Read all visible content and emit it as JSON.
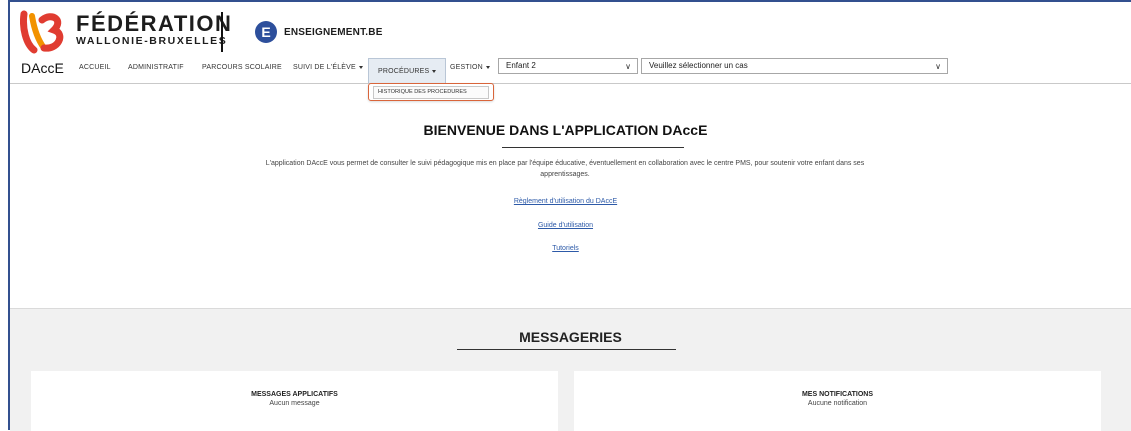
{
  "header": {
    "logo_line1": "FÉDÉRATION",
    "logo_line2": "WALLONIE-BRUXELLES",
    "ens_badge": "E",
    "ens_text": "ENSEIGNEMENT.BE"
  },
  "nav": {
    "app_name": "DAccE",
    "items": [
      {
        "label": "ACCUEIL"
      },
      {
        "label": "ADMINISTRATIF"
      },
      {
        "label": "PARCOURS SCOLAIRE"
      },
      {
        "label": "SUIVI DE L'ÉLÈVE"
      },
      {
        "label": "PROCÉDURES"
      },
      {
        "label": "GESTION"
      }
    ],
    "child_select": "Enfant 2",
    "case_select": "Veuillez sélectionner un cas"
  },
  "dropdown": {
    "item": "HISTORIQUE DES PROCEDURES"
  },
  "welcome": {
    "title": "BIENVENUE DANS L'APPLICATION DAccE",
    "desc_line1": "L'application DAccE vous permet de consulter le suivi pédagogique mis en place par l'équipe éducative, éventuellement en collaboration avec le centre PMS, pour soutenir votre enfant dans ses",
    "desc_line2": "apprentissages.",
    "link_rules": "Règlement d'utilisation du DAccE",
    "link_guide": "Guide d'utilisation",
    "link_tutorials": "Tutoriels"
  },
  "messageries": {
    "title": "MESSAGERIES",
    "card1_title": "MESSAGES APPLICATIFS",
    "card1_sub": "Aucun message",
    "card2_title": "MES NOTIFICATIONS",
    "card2_sub": "Aucune notification"
  },
  "colors": {
    "brand_blue": "#2d4f9c",
    "highlight_orange": "#d9653b",
    "logo_red": "#e03c31",
    "logo_orange": "#f29200"
  }
}
